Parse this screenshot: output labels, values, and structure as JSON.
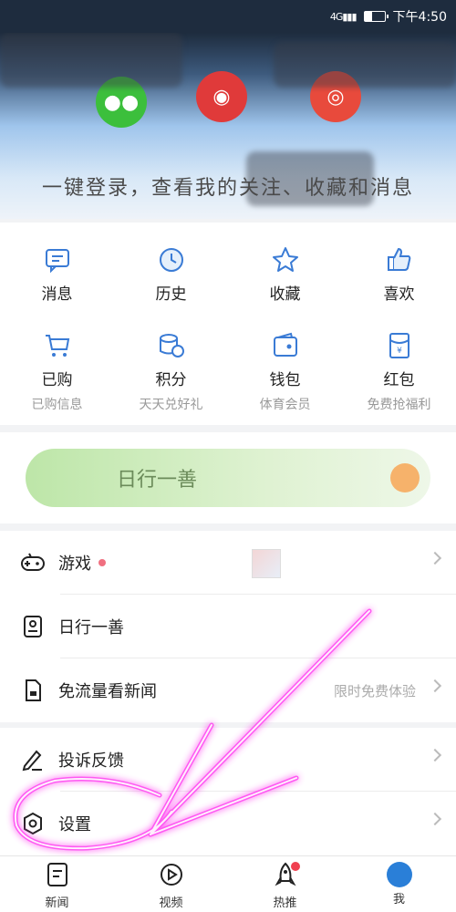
{
  "status_bar": {
    "signal": "4G▮▮▮",
    "time": "下午4:50"
  },
  "header": {
    "login_prompt": "一键登录，查看我的关注、收藏和消息"
  },
  "grid": [
    {
      "label": "消息",
      "icon": "message-icon"
    },
    {
      "label": "历史",
      "icon": "clock-icon"
    },
    {
      "label": "收藏",
      "icon": "star-icon"
    },
    {
      "label": "喜欢",
      "icon": "thumbs-up-icon"
    },
    {
      "label": "已购",
      "sub": "已购信息",
      "icon": "cart-icon"
    },
    {
      "label": "积分",
      "sub": "天天兑好礼",
      "icon": "coins-icon"
    },
    {
      "label": "钱包",
      "sub": "体育会员",
      "icon": "wallet-icon"
    },
    {
      "label": "红包",
      "sub": "免费抢福利",
      "icon": "red-packet-icon"
    }
  ],
  "banner": {
    "text": "日行一善"
  },
  "list1": [
    {
      "label": "游戏",
      "icon": "gamepad-icon"
    },
    {
      "label": "日行一善",
      "icon": "charity-icon"
    },
    {
      "label": "免流量看新闻",
      "extra": "限时免费体验",
      "icon": "sim-card-icon"
    }
  ],
  "list2": [
    {
      "label": "投诉反馈",
      "icon": "pencil-icon"
    },
    {
      "label": "设置",
      "icon": "settings-icon"
    }
  ],
  "nav": [
    {
      "label": "新闻",
      "icon": "news-icon"
    },
    {
      "label": "视频",
      "icon": "play-icon"
    },
    {
      "label": "热推",
      "icon": "rocket-icon"
    },
    {
      "label": "我",
      "icon": "me-icon"
    }
  ],
  "colors": {
    "accent": "#3a7bd5",
    "annotation": "#ff3cf0"
  }
}
